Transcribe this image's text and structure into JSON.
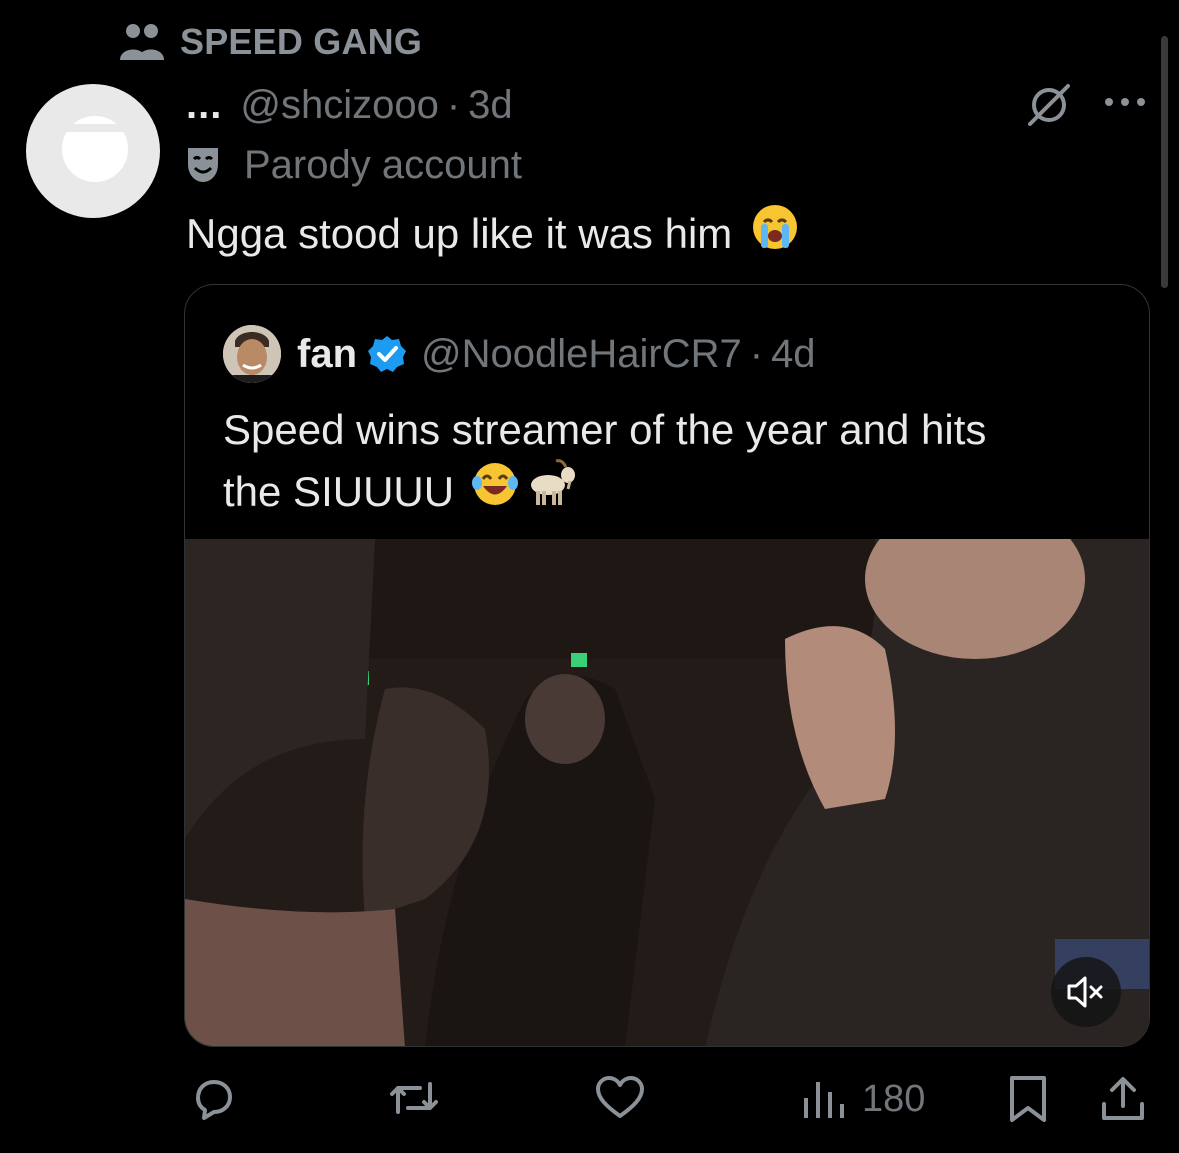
{
  "community": {
    "name": "SPEED GANG",
    "icon": "community-icon"
  },
  "tweet": {
    "display_name": "...",
    "handle": "@shcizooo",
    "separator": "·",
    "age": "3d",
    "label": "Parody account",
    "label_icon": "theater-mask-icon",
    "text": "Ngga stood up like it was him",
    "emoji": "😭"
  },
  "quote": {
    "name": "fan",
    "verified": true,
    "handle": "@NoodleHairCR7",
    "separator": "·",
    "age": "4d",
    "text_line1": "Speed wins streamer of the year and hits",
    "text_line2": "the SIUUUU",
    "emojis": "😂🐐"
  },
  "video": {
    "muted": true
  },
  "actions": {
    "replies_icon": "reply-icon",
    "reposts_icon": "repost-icon",
    "likes_icon": "heart-icon",
    "views": "180",
    "bookmark_icon": "bookmark-icon",
    "share_icon": "share-icon"
  },
  "colors": {
    "background": "#000000",
    "text": "#e7e9ea",
    "muted": "#71767b",
    "verified": "#1d9bf0"
  }
}
